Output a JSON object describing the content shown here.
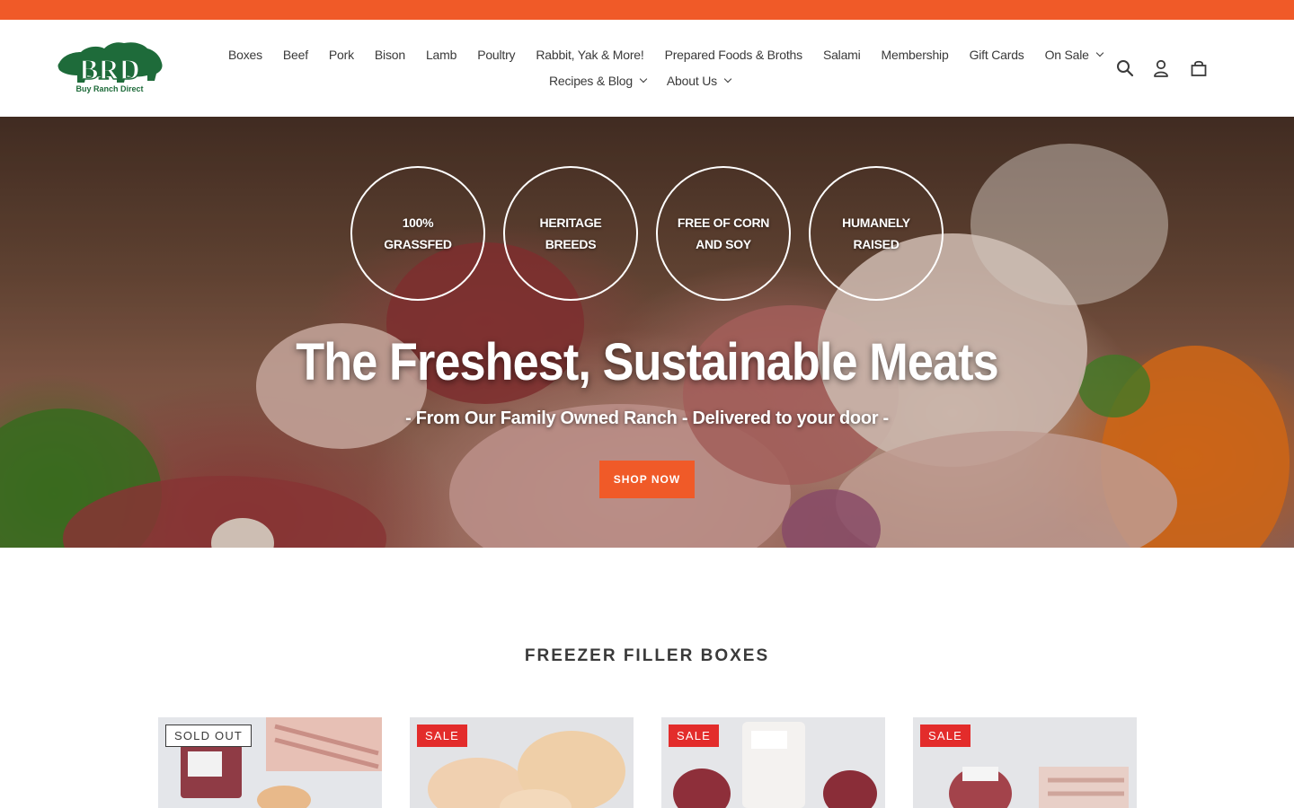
{
  "brand": {
    "logo_text": "BRD",
    "logo_subtext": "Buy Ranch Direct",
    "accent_color": "#f05a28",
    "logo_color": "#1e6b3a"
  },
  "nav": {
    "row1": [
      {
        "label": "Boxes",
        "dropdown": false
      },
      {
        "label": "Beef",
        "dropdown": false
      },
      {
        "label": "Pork",
        "dropdown": false
      },
      {
        "label": "Bison",
        "dropdown": false
      },
      {
        "label": "Lamb",
        "dropdown": false
      },
      {
        "label": "Poultry",
        "dropdown": false
      },
      {
        "label": "Rabbit, Yak & More!",
        "dropdown": false
      },
      {
        "label": "Prepared Foods & Broths",
        "dropdown": false
      },
      {
        "label": "Salami",
        "dropdown": false
      },
      {
        "label": "Membership",
        "dropdown": false
      },
      {
        "label": "Gift Cards",
        "dropdown": false
      },
      {
        "label": "On Sale",
        "dropdown": true
      }
    ],
    "row2": [
      {
        "label": "Recipes & Blog",
        "dropdown": true
      },
      {
        "label": "About Us",
        "dropdown": true
      }
    ]
  },
  "header_icons": [
    "search-icon",
    "account-icon",
    "cart-icon"
  ],
  "hero": {
    "badges": [
      "100% GRASSFED",
      "HERITAGE BREEDS",
      "FREE OF CORN AND SOY",
      "HUMANELY RAISED"
    ],
    "title": "The Freshest, Sustainable Meats",
    "subtitle": "- From Our Family Owned Ranch - Delivered to your door -",
    "cta_label": "SHOP NOW"
  },
  "collection": {
    "title": "FREEZER FILLER BOXES",
    "products": [
      {
        "label": "SOLD OUT",
        "label_type": "sold"
      },
      {
        "label": "SALE",
        "label_type": "sale"
      },
      {
        "label": "SALE",
        "label_type": "sale"
      },
      {
        "label": "SALE",
        "label_type": "sale"
      }
    ]
  }
}
